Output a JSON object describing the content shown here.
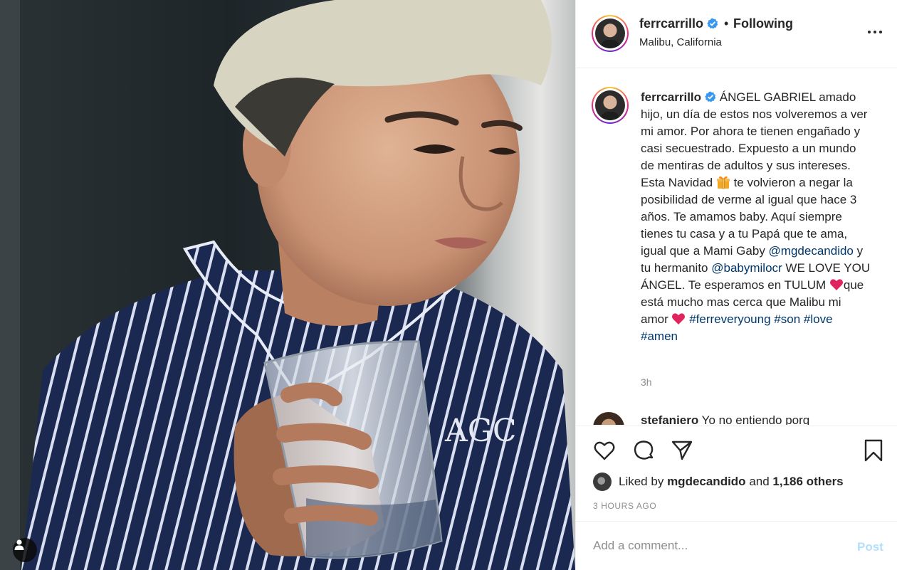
{
  "post": {
    "username": "ferrcarrillo",
    "separator": "•",
    "follow_status": "Following",
    "location": "Malibu, California"
  },
  "caption": {
    "username": "ferrcarrillo",
    "text_1": "ÁNGEL GABRIEL amado hijo, un día de estos nos volveremos a ver mi amor. Por ahora te tienen engañado y casi secuestrado. Expuesto a un mundo de mentiras de adultos y sus intereses. Esta Navidad ",
    "emoji_gift": "gift-emoji",
    "text_2": " te volvieron a negar la posibilidad de verme al igual que hace 3 años. Te amamos baby. Aquí siempre tienes tu casa y a tu Papá que te ama, igual que a Mami Gaby ",
    "mention_1": "@mgdecandido",
    "text_3": " y tu hermanito ",
    "mention_2": "@babymilocr",
    "text_4": " WE LOVE YOU ÁNGEL. Te esperamos en TULUM ",
    "emoji_heart_1": "heart-emoji",
    "text_5": "que está mucho mas cerca que Malibu mi amor ",
    "emoji_heart_2": "heart-emoji",
    "hashtag_1": "#ferreveryoung",
    "hashtag_2": "#son",
    "hashtag_3": "#love",
    "hashtag_4": "#amen",
    "time_ago": "3h"
  },
  "next_comment": {
    "username": "stefaniero",
    "text": "Yo no entiendo porq"
  },
  "actions": {
    "like_icon": "heart-outline-icon",
    "comment_icon": "speech-bubble-icon",
    "share_icon": "paper-plane-icon",
    "save_icon": "bookmark-icon"
  },
  "likes": {
    "prefix": "Liked by",
    "user": "mgdecandido",
    "connector": "and",
    "others": "1,186 others"
  },
  "timestamp": "3 HOURS AGO",
  "comment_box": {
    "placeholder": "Add a comment...",
    "post_label": "Post"
  },
  "photo": {
    "shirt_monogram": "AGC"
  },
  "colors": {
    "verified_blue": "#3897f0",
    "link_navy": "#00376b",
    "post_disabled": "#b2dffc",
    "heart_red": "#e0245e",
    "pajama_navy": "#1c2a55"
  }
}
